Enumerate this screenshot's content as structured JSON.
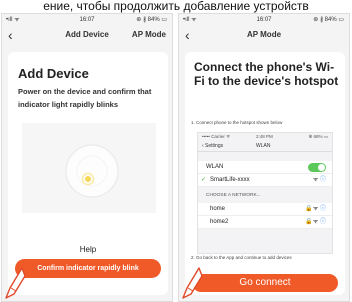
{
  "caption": "ение, чтобы продолжить добавление устройств",
  "left": {
    "status": {
      "signal": "•ıll ᯤ",
      "time": "16:07",
      "battery": "⊛ ∦ 84% ▭"
    },
    "nav": {
      "title": "Add Device",
      "right": "AP Mode"
    },
    "heading": "Add Device",
    "description": "Power on the device and confirm that indicator light rapidly blinks",
    "help": "Help",
    "button": "Confirm indicator rapidly blink"
  },
  "right": {
    "status": {
      "signal": "•ıll ᯤ",
      "time": "16:07",
      "battery": "⊛ ∦ 84% ▭"
    },
    "nav": {
      "title": "AP Mode"
    },
    "heading": "Connect the phone's Wi-Fi to the device's hotspot",
    "step1": "1. Connect phone to the hotspot shown below",
    "mini": {
      "status": {
        "carrier": "••••• Carrier ᯤ",
        "time": "2:48 PM",
        "battery": "✻ 68% ▭"
      },
      "back": "‹ Settings",
      "title": "WLAN",
      "wlan_label": "WLAN",
      "connected": "SmartLife-xxxx",
      "choose": "CHOOSE A NETWORK...",
      "networks": [
        "home",
        "home2"
      ]
    },
    "step2": "2. Go back to the App and continue to add devices",
    "button": "Go connect"
  },
  "colors": {
    "accent": "#f05a28",
    "toggle": "#5cc85c",
    "info": "#2e7cf6"
  }
}
